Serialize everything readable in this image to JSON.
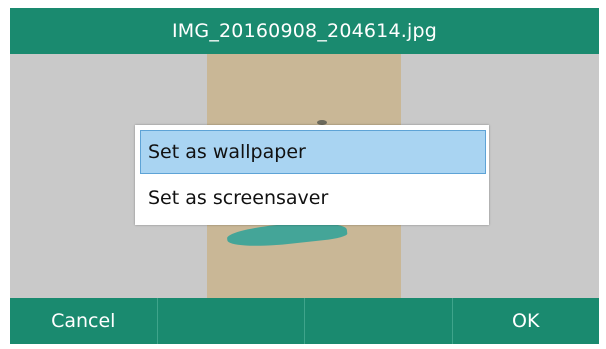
{
  "title_bar": {
    "title": "IMG_20160908_204614.jpg"
  },
  "menu": {
    "items": [
      {
        "label": "Set as wallpaper",
        "selected": true
      },
      {
        "label": "Set as screensaver",
        "selected": false
      }
    ]
  },
  "softkeys": [
    {
      "label": "Cancel"
    },
    {
      "label": ""
    },
    {
      "label": ""
    },
    {
      "label": "OK"
    }
  ],
  "colors": {
    "title_bar": "#1a8a6f",
    "softkey_bar": "#1a8a6f",
    "selection_fill": "#a9d4f2",
    "selection_border": "#5ea3d6"
  }
}
